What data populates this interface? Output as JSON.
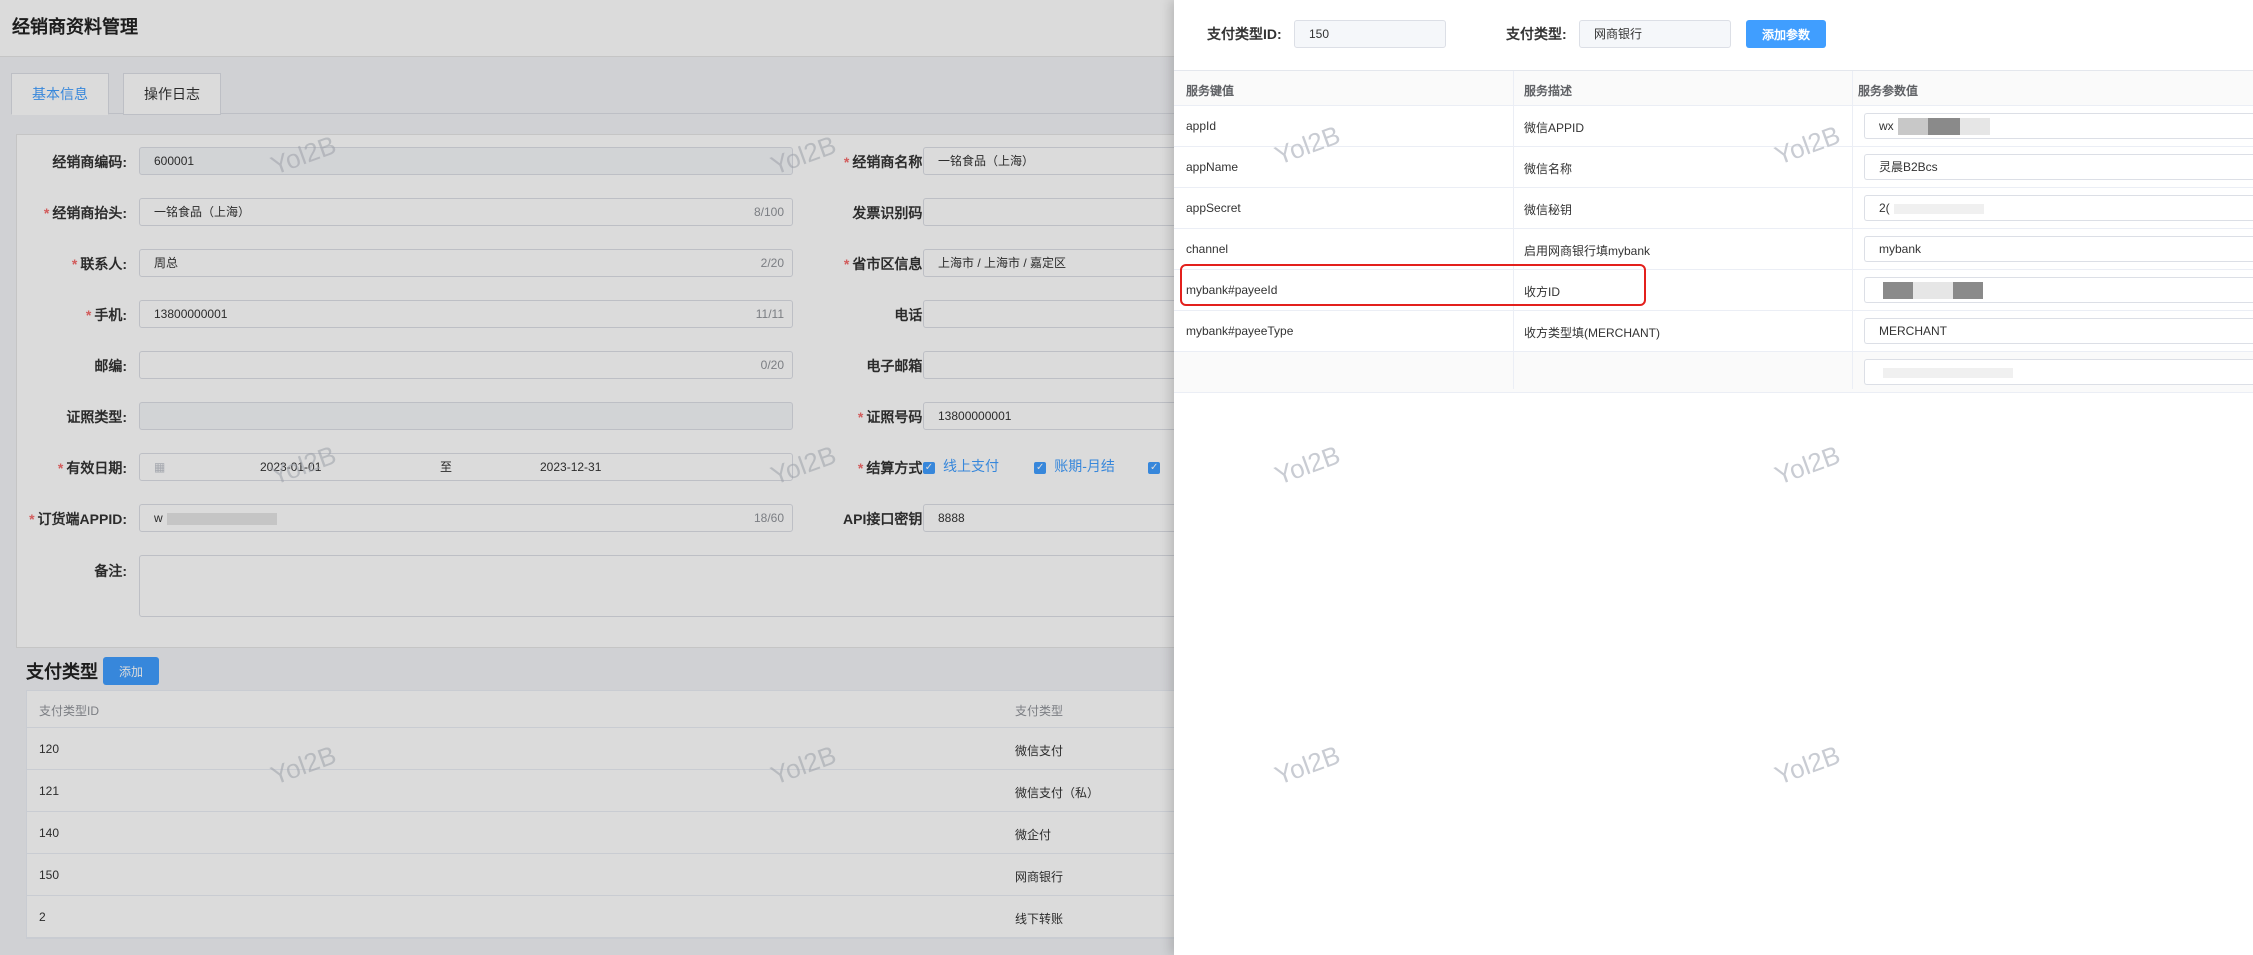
{
  "page": {
    "title": "经销商资料管理"
  },
  "tabs": [
    {
      "label": "基本信息",
      "active": true
    },
    {
      "label": "操作日志",
      "active": false
    }
  ],
  "form": {
    "dealer_code": {
      "label": "经销商编码:",
      "value": "600001"
    },
    "dealer_name": {
      "label": "经销商名称:",
      "value": "一铭食品（上海）"
    },
    "dealer_header": {
      "label": "经销商抬头:",
      "value": "一铭食品（上海）",
      "count": "8/100"
    },
    "invoice_id": {
      "label": "发票识别码:",
      "value": ""
    },
    "contact": {
      "label": "联系人:",
      "value": "周总",
      "count": "2/20"
    },
    "region": {
      "label": "省市区信息:",
      "value": "上海市 / 上海市 / 嘉定区"
    },
    "mobile": {
      "label": "手机:",
      "value": "13800000001",
      "count": "11/11"
    },
    "phone": {
      "label": "电话:",
      "value": ""
    },
    "zip": {
      "label": "邮编:",
      "value": "",
      "count": "0/20"
    },
    "email": {
      "label": "电子邮箱:",
      "value": ""
    },
    "cert_type": {
      "label": "证照类型:",
      "value": ""
    },
    "cert_no": {
      "label": "证照号码:",
      "value": "13800000001"
    },
    "valid_date": {
      "label": "有效日期:",
      "start": "2023-01-01",
      "sep": "至",
      "end": "2023-12-31"
    },
    "settle": {
      "label": "结算方式:",
      "options": [
        "线上支付",
        "账期-月结"
      ]
    },
    "appid": {
      "label": "订货端APPID:",
      "value": "w",
      "count": "18/60"
    },
    "api_secret": {
      "label": "API接口密钥:",
      "value": "8888"
    },
    "remark": {
      "label": "备注:",
      "value": ""
    }
  },
  "payment_types": {
    "title": "支付类型",
    "add_label": "添加",
    "columns": [
      "支付类型ID",
      "支付类型"
    ],
    "rows": [
      {
        "id": "120",
        "name": "微信支付"
      },
      {
        "id": "121",
        "name": "微信支付（私）"
      },
      {
        "id": "140",
        "name": "微企付"
      },
      {
        "id": "150",
        "name": "网商银行"
      },
      {
        "id": "2",
        "name": "线下转账"
      }
    ]
  },
  "watermark": "Yol2B",
  "drawer": {
    "type_id_label": "支付类型ID:",
    "type_id_value": "150",
    "type_label": "支付类型:",
    "type_value": "网商银行",
    "add_param_label": "添加参数",
    "columns": [
      "服务键值",
      "服务描述",
      "服务参数值"
    ],
    "rows": [
      {
        "key": "appId",
        "desc": "微信APPID",
        "value": "wx"
      },
      {
        "key": "appName",
        "desc": "微信名称",
        "value": "灵晨B2Bcs"
      },
      {
        "key": "appSecret",
        "desc": "微信秘钥",
        "value": "2("
      },
      {
        "key": "channel",
        "desc": "启用网商银行填mybank",
        "value": "mybank"
      },
      {
        "key": "mybank#payeeId",
        "desc": "收方ID",
        "value": ""
      },
      {
        "key": "mybank#payeeType",
        "desc": "收方类型填(MERCHANT)",
        "value": "MERCHANT"
      }
    ]
  },
  "colors": {
    "accent": "#409eff",
    "highlight": "#e3201c",
    "required": "#f56c6c"
  }
}
